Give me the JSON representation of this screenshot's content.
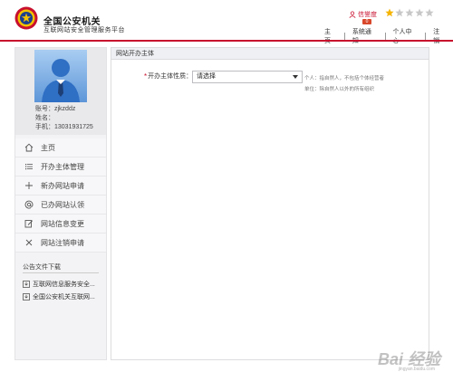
{
  "header": {
    "title": "全国公安机关",
    "subtitle": "互联网站安全管理服务平台",
    "credit_label": "信誉度",
    "credit_badge": "0",
    "rating": 1,
    "rating_max": 5,
    "nav": [
      "主页",
      "系统通知",
      "个人中心",
      "注销"
    ]
  },
  "profile": {
    "account": "账号：zjkzddz",
    "name": "姓名：",
    "phone": "手机：13031931725"
  },
  "menu": [
    {
      "label": "主页",
      "icon": "home-icon"
    },
    {
      "label": "开办主体管理",
      "icon": "list-icon"
    },
    {
      "label": "新办网站申请",
      "icon": "plus-icon"
    },
    {
      "label": "已办网站认领",
      "icon": "at-icon"
    },
    {
      "label": "网站信息变更",
      "icon": "edit-icon"
    },
    {
      "label": "网站注销申请",
      "icon": "close-icon"
    }
  ],
  "docs": {
    "title": "公告文件下载",
    "items": [
      "互联网信息服务安全...",
      "全国公安机关互联网..."
    ]
  },
  "panel": {
    "title": "网站开办主体",
    "field_label": "开办主体性质：",
    "select_value": "请选择",
    "hint_person": "个人：指自然人，不包括个体经营者",
    "hint_org": "单位：除自然人以外的所有组织"
  },
  "watermark": {
    "text": "Bai 经验",
    "sub": "jingyan.baidu.com"
  },
  "colors": {
    "accent_red": "#c8102e",
    "star_gold": "#f5b400",
    "star_empty": "#c8c8c8",
    "avatar_blue": "#2f6fc4"
  }
}
